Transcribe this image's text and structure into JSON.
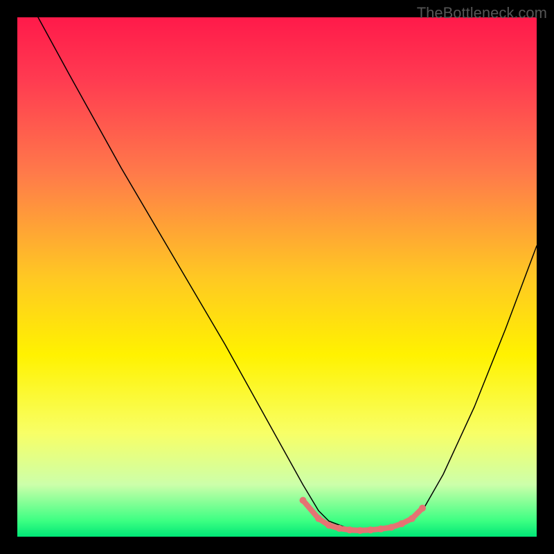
{
  "watermark": "TheBottleneck.com",
  "chart_data": {
    "type": "line",
    "title": "",
    "xlabel": "",
    "ylabel": "",
    "xlim": [
      0,
      100
    ],
    "ylim": [
      0,
      100
    ],
    "background_gradient": {
      "stops": [
        {
          "offset": 0.0,
          "color": "#ff1a4a"
        },
        {
          "offset": 0.12,
          "color": "#ff3b51"
        },
        {
          "offset": 0.3,
          "color": "#ff7a4a"
        },
        {
          "offset": 0.5,
          "color": "#ffc823"
        },
        {
          "offset": 0.65,
          "color": "#fff200"
        },
        {
          "offset": 0.8,
          "color": "#f8ff66"
        },
        {
          "offset": 0.9,
          "color": "#ccffaa"
        },
        {
          "offset": 0.97,
          "color": "#3bff82"
        },
        {
          "offset": 1.0,
          "color": "#00e676"
        }
      ]
    },
    "series": [
      {
        "name": "bottleneck-curve",
        "color": "#000000",
        "width": 1.5,
        "x": [
          4,
          10,
          20,
          30,
          40,
          50,
          55,
          58,
          60,
          64,
          68,
          72,
          76,
          78,
          82,
          88,
          94,
          100
        ],
        "y": [
          100,
          89,
          71,
          54,
          37,
          19,
          10,
          5,
          3,
          1.5,
          1.2,
          1.5,
          3,
          5,
          12,
          25,
          40,
          56
        ]
      },
      {
        "name": "optimal-zone-marker",
        "color": "#e57373",
        "width": 8,
        "x": [
          55,
          58,
          60,
          62,
          64,
          66,
          68,
          70,
          72,
          74,
          76,
          78
        ],
        "y": [
          7,
          3.5,
          2.2,
          1.6,
          1.3,
          1.2,
          1.3,
          1.5,
          1.8,
          2.5,
          3.5,
          5.5
        ]
      }
    ]
  }
}
